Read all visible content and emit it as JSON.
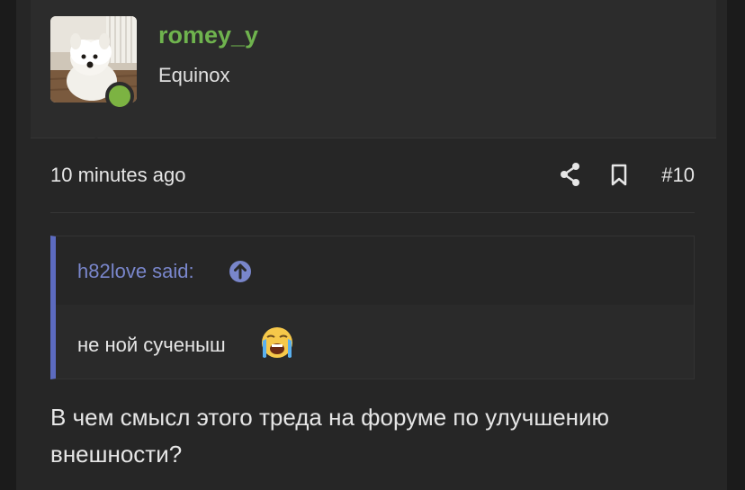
{
  "post": {
    "user": {
      "username": "romey_y",
      "user_title": "Equinox",
      "avatar_icon": "dog-avatar",
      "status_color": "#7cb342"
    },
    "timestamp": "10 minutes ago",
    "actions": {
      "share_icon": "share-icon",
      "bookmark_icon": "bookmark-icon",
      "post_number": "#10"
    },
    "quote": {
      "author_label": "h82love said:",
      "jump_icon": "arrow-up-circle-icon",
      "text": "не ной сученыш",
      "emoji": "loudly-crying-face"
    },
    "message": "В чем смысл этого треда на форуме по улучшению внешности?"
  },
  "colors": {
    "username": "#6fb34e",
    "quote_accent": "#5c6bc0",
    "quote_link": "#7986cb",
    "background": "#262626"
  }
}
